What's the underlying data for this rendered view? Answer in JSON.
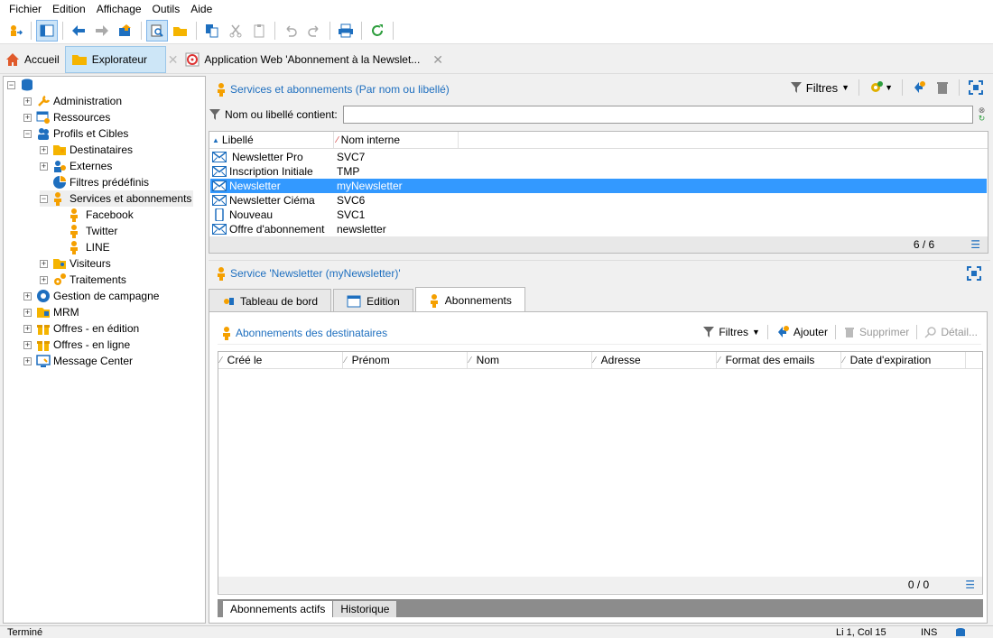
{
  "menu": [
    "Fichier",
    "Edition",
    "Affichage",
    "Outils",
    "Aide"
  ],
  "tabs": {
    "home": "Accueil",
    "explorer": "Explorateur",
    "webapp": "Application Web 'Abonnement à la Newslet..."
  },
  "tree": {
    "root_label": "",
    "items": [
      {
        "label": "Administration",
        "level": 1,
        "pm": "+"
      },
      {
        "label": "Ressources",
        "level": 1,
        "pm": "+"
      },
      {
        "label": "Profils et Cibles",
        "level": 1,
        "pm": "−"
      },
      {
        "label": "Destinataires",
        "level": 2,
        "pm": "+"
      },
      {
        "label": "Externes",
        "level": 2,
        "pm": "+"
      },
      {
        "label": "Filtres prédéfinis",
        "level": 2,
        "pm": ""
      },
      {
        "label": "Services et abonnements",
        "level": 2,
        "pm": "−"
      },
      {
        "label": "Facebook",
        "level": 3,
        "pm": ""
      },
      {
        "label": "Twitter",
        "level": 3,
        "pm": ""
      },
      {
        "label": "LINE",
        "level": 3,
        "pm": ""
      },
      {
        "label": "Visiteurs",
        "level": 2,
        "pm": "+"
      },
      {
        "label": "Traitements",
        "level": 2,
        "pm": "+"
      },
      {
        "label": "Gestion de campagne",
        "level": 1,
        "pm": "+"
      },
      {
        "label": "MRM",
        "level": 1,
        "pm": "+"
      },
      {
        "label": "Offres - en édition",
        "level": 1,
        "pm": "+"
      },
      {
        "label": "Offres - en ligne",
        "level": 1,
        "pm": "+"
      },
      {
        "label": "Message Center",
        "level": 1,
        "pm": "+"
      }
    ]
  },
  "services_panel": {
    "title": "Services et abonnements (Par nom ou libellé)",
    "filters_label": "Filtres",
    "search_label": "Nom ou libellé contient:",
    "search_value": "",
    "columns": [
      "Libellé",
      "Nom interne"
    ],
    "rows": [
      {
        "label": "Newsletter Pro",
        "name": "SVC7",
        "icon": "mail"
      },
      {
        "label": "Inscription Initiale",
        "name": "TMP",
        "icon": "mail"
      },
      {
        "label": "Newsletter",
        "name": "myNewsletter",
        "icon": "mail",
        "selected": true
      },
      {
        "label": "Newsletter Ciéma",
        "name": "SVC6",
        "icon": "mail"
      },
      {
        "label": "Nouveau",
        "name": "SVC1",
        "icon": "mobile"
      },
      {
        "label": "Offre d'abonnement",
        "name": "newsletter",
        "icon": "mail"
      }
    ],
    "count": "6 / 6"
  },
  "detail_panel": {
    "title": "Service 'Newsletter (myNewsletter)'",
    "tabs": [
      "Tableau de bord",
      "Edition",
      "Abonnements"
    ],
    "sub_title": "Abonnements des destinataires",
    "filters_label": "Filtres",
    "add_label": "Ajouter",
    "delete_label": "Supprimer",
    "detail_label": "Détail...",
    "columns": [
      "Créé le",
      "Prénom",
      "Nom",
      "Adresse",
      "Format des emails",
      "Date d'expiration"
    ],
    "count": "0 / 0",
    "bottom_tabs": [
      "Abonnements actifs",
      "Historique"
    ]
  },
  "status": {
    "left": "Terminé",
    "pos": "Li 1, Col 15",
    "mode": "INS"
  },
  "colors": {
    "accent": "#1e6fbf",
    "selection": "#3399ff",
    "orange": "#f5a000"
  }
}
